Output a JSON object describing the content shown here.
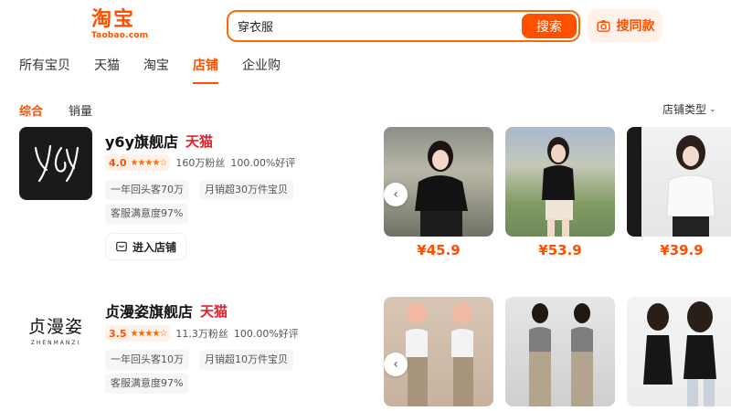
{
  "header": {
    "logo_cn": "淘宝",
    "logo_en": "Taobao.com",
    "search_value": "穿衣服",
    "search_button": "搜索",
    "image_search_label": "搜同款"
  },
  "tabs": [
    "所有宝贝",
    "天猫",
    "淘宝",
    "店铺",
    "企业购"
  ],
  "active_tab": "店铺",
  "sort": {
    "items": [
      "综合",
      "销量"
    ],
    "shop_type_label": "店铺类型"
  },
  "shops": [
    {
      "logo_text": "y6y",
      "name": "y6y旗舰店",
      "tag": "天猫",
      "rating": "4.0",
      "stars": "★★★★☆",
      "fans": "160万粉丝",
      "positive": "100.00%好评",
      "repeat": "一年回头客70万",
      "monthly": "月销超30万件宝贝",
      "satisfaction": "客服满意度97%",
      "enter": "进入店铺",
      "products": [
        {
          "price": "¥45.9"
        },
        {
          "price": "¥53.9"
        },
        {
          "price": "¥39.9"
        }
      ]
    },
    {
      "logo_text": "贞漫姿",
      "logo_sub": "ZHENMANZI",
      "name": "贞漫姿旗舰店",
      "tag": "天猫",
      "rating": "3.5",
      "stars": "★★★★☆",
      "fans": "11.3万粉丝",
      "positive": "100.00%好评",
      "repeat": "一年回头客10万",
      "monthly": "月销超10万件宝贝",
      "satisfaction": "客服满意度97%",
      "products": [
        {},
        {},
        {}
      ]
    }
  ],
  "colors": {
    "accent": "#ff5000",
    "tmall": "#e5202c"
  }
}
